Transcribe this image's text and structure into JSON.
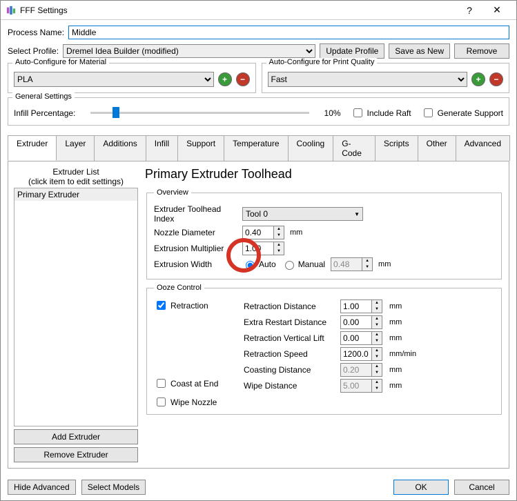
{
  "window": {
    "title": "FFF Settings",
    "help": "?",
    "close": "✕"
  },
  "process_name_label": "Process Name:",
  "process_name_value": "Middle",
  "select_profile_label": "Select Profile:",
  "select_profile_value": "Dremel Idea Builder (modified)",
  "btn_update_profile": "Update Profile",
  "btn_save_as_new": "Save as New",
  "btn_remove": "Remove",
  "auto_material": {
    "title": "Auto-Configure for Material",
    "value": "PLA"
  },
  "auto_quality": {
    "title": "Auto-Configure for Print Quality",
    "value": "Fast"
  },
  "general": {
    "title": "General Settings",
    "infill_label": "Infill Percentage:",
    "infill_value": "10%",
    "include_raft": "Include Raft",
    "generate_support": "Generate Support"
  },
  "tabs": [
    "Extruder",
    "Layer",
    "Additions",
    "Infill",
    "Support",
    "Temperature",
    "Cooling",
    "G-Code",
    "Scripts",
    "Other",
    "Advanced"
  ],
  "extruder_list": {
    "header1": "Extruder List",
    "header2": "(click item to edit settings)",
    "items": [
      "Primary Extruder"
    ],
    "add": "Add Extruder",
    "remove": "Remove Extruder"
  },
  "extruder_panel": {
    "heading": "Primary Extruder Toolhead",
    "overview": "Overview",
    "toolhead_index_label": "Extruder Toolhead Index",
    "toolhead_index_value": "Tool 0",
    "nozzle_diameter_label": "Nozzle Diameter",
    "nozzle_diameter_value": "0.40",
    "nozzle_diameter_unit": "mm",
    "extrusion_multiplier_label": "Extrusion Multiplier",
    "extrusion_multiplier_value": "1.00",
    "extrusion_width_label": "Extrusion Width",
    "ew_auto": "Auto",
    "ew_manual": "Manual",
    "ew_manual_value": "0.48",
    "ew_unit": "mm",
    "ooze_title": "Ooze Control",
    "retraction": "Retraction",
    "coast": "Coast at End",
    "wipe": "Wipe Nozzle",
    "retraction_distance_label": "Retraction Distance",
    "retraction_distance_value": "1.00",
    "extra_restart_label": "Extra Restart Distance",
    "extra_restart_value": "0.00",
    "vertical_lift_label": "Retraction Vertical Lift",
    "vertical_lift_value": "0.00",
    "retraction_speed_label": "Retraction Speed",
    "retraction_speed_value": "1200.0",
    "retraction_speed_unit": "mm/min",
    "coasting_distance_label": "Coasting Distance",
    "coasting_distance_value": "0.20",
    "wipe_distance_label": "Wipe Distance",
    "wipe_distance_value": "5.00",
    "mm": "mm"
  },
  "footer": {
    "hide_advanced": "Hide Advanced",
    "select_models": "Select Models",
    "ok": "OK",
    "cancel": "Cancel"
  },
  "annotation": {
    "red_circle_target": "extrusion-width-auto-radio"
  }
}
